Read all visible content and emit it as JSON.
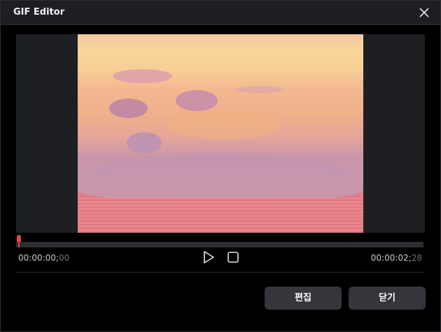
{
  "window": {
    "title": "GIF Editor"
  },
  "icons": {
    "close": "close-icon",
    "play": "play-icon",
    "stop": "stop-icon"
  },
  "player": {
    "current_time": "00:00:00;",
    "current_frame": "00",
    "total_time": "00:00:02;",
    "total_frame": "28",
    "progress": 0
  },
  "buttons": {
    "edit_label": "편집",
    "close_label": "닫기"
  },
  "colors": {
    "accent": "#e8404d",
    "button_bg": "#34363c",
    "titlebar_bg": "#1d1e22"
  }
}
